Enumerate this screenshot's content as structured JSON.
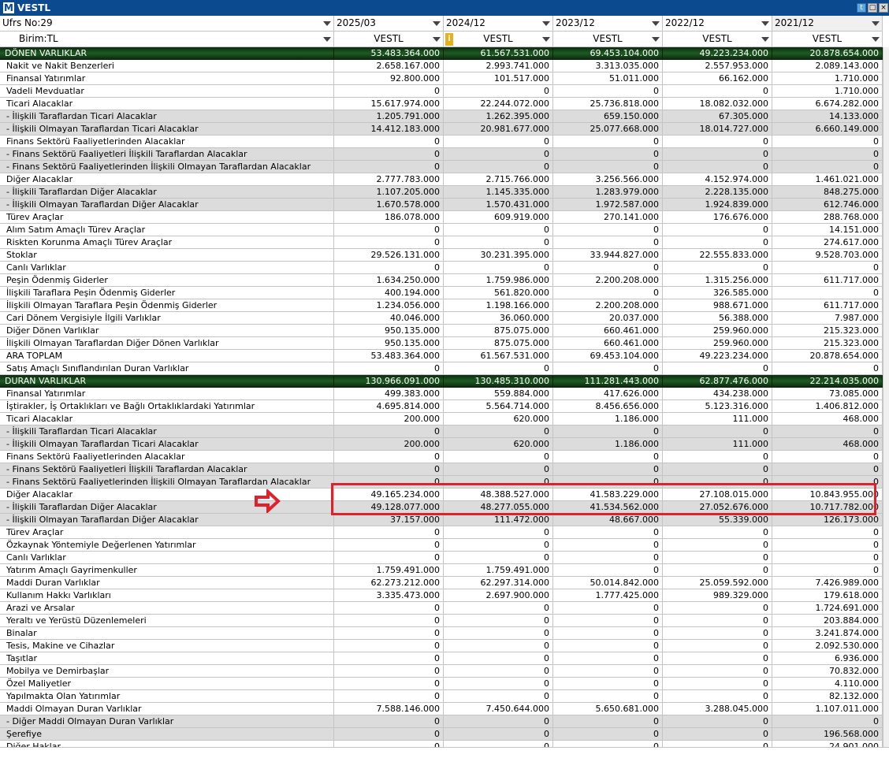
{
  "window": {
    "title": "VESTL",
    "logo": "M",
    "buttons": [
      "twitter-icon",
      "restore-icon",
      "close-icon"
    ]
  },
  "header": {
    "ufrs": "Ufrs No:29",
    "birim": "Birim:TL",
    "periods": [
      "2025/03",
      "2024/12",
      "2023/12",
      "2022/12",
      "2021/12"
    ],
    "tickers": [
      "VESTL",
      "VESTL",
      "VESTL",
      "VESTL",
      "VESTL"
    ],
    "info_icon": "i"
  },
  "rows": [
    {
      "label": "DÖNEN VARLIKLAR",
      "values": [
        "53.483.364.000",
        "61.567.531.000",
        "69.453.104.000",
        "49.223.234.000",
        "20.878.654.000"
      ],
      "type": "sec"
    },
    {
      "label": "Nakit ve Nakit Benzerleri",
      "values": [
        "2.658.167.000",
        "2.993.741.000",
        "3.313.035.000",
        "2.557.953.000",
        "2.089.143.000"
      ]
    },
    {
      "label": "Finansal Yatırımlar",
      "values": [
        "92.800.000",
        "101.517.000",
        "51.011.000",
        "66.162.000",
        "1.710.000"
      ]
    },
    {
      "label": "Vadeli Mevduatlar",
      "values": [
        "0",
        "0",
        "0",
        "0",
        "1.710.000"
      ]
    },
    {
      "label": "Ticari Alacaklar",
      "values": [
        "15.617.974.000",
        "22.244.072.000",
        "25.736.818.000",
        "18.082.032.000",
        "6.674.282.000"
      ]
    },
    {
      "label": "- İlişkili Taraflardan Ticari Alacaklar",
      "values": [
        "1.205.791.000",
        "1.262.395.000",
        "659.150.000",
        "67.305.000",
        "14.133.000"
      ],
      "type": "alt"
    },
    {
      "label": "- İlişkili Olmayan Taraflardan Ticari Alacaklar",
      "values": [
        "14.412.183.000",
        "20.981.677.000",
        "25.077.668.000",
        "18.014.727.000",
        "6.660.149.000"
      ],
      "type": "alt"
    },
    {
      "label": "Finans Sektörü Faaliyetlerinden Alacaklar",
      "values": [
        "0",
        "0",
        "0",
        "0",
        "0"
      ]
    },
    {
      "label": "- Finans Sektörü Faaliyetleri İlişkili Taraflardan Alacaklar",
      "values": [
        "0",
        "0",
        "0",
        "0",
        "0"
      ],
      "type": "alt"
    },
    {
      "label": "- Finans Sektörü Faaliyetlerinden İlişkili Olmayan Taraflardan Alacaklar",
      "values": [
        "0",
        "0",
        "0",
        "0",
        "0"
      ],
      "type": "alt"
    },
    {
      "label": "Diğer Alacaklar",
      "values": [
        "2.777.783.000",
        "2.715.766.000",
        "3.256.566.000",
        "4.152.974.000",
        "1.461.021.000"
      ]
    },
    {
      "label": "- İlişkili Taraflardan Diğer Alacaklar",
      "values": [
        "1.107.205.000",
        "1.145.335.000",
        "1.283.979.000",
        "2.228.135.000",
        "848.275.000"
      ],
      "type": "alt"
    },
    {
      "label": "- İlişkili Olmayan Taraflardan Diğer Alacaklar",
      "values": [
        "1.670.578.000",
        "1.570.431.000",
        "1.972.587.000",
        "1.924.839.000",
        "612.746.000"
      ],
      "type": "alt"
    },
    {
      "label": "Türev Araçlar",
      "values": [
        "186.078.000",
        "609.919.000",
        "270.141.000",
        "176.676.000",
        "288.768.000"
      ]
    },
    {
      "label": "Alım Satım Amaçlı Türev Araçlar",
      "values": [
        "0",
        "0",
        "0",
        "0",
        "14.151.000"
      ]
    },
    {
      "label": "Riskten Korunma Amaçlı Türev Araçlar",
      "values": [
        "0",
        "0",
        "0",
        "0",
        "274.617.000"
      ]
    },
    {
      "label": "Stoklar",
      "values": [
        "29.526.131.000",
        "30.231.395.000",
        "33.944.827.000",
        "22.555.833.000",
        "9.528.703.000"
      ]
    },
    {
      "label": "Canlı Varlıklar",
      "values": [
        "0",
        "0",
        "0",
        "0",
        "0"
      ]
    },
    {
      "label": "Peşin Ödenmiş Giderler",
      "values": [
        "1.634.250.000",
        "1.759.986.000",
        "2.200.208.000",
        "1.315.256.000",
        "611.717.000"
      ]
    },
    {
      "label": "İlişkili Taraflara Peşin Ödenmiş Giderler",
      "values": [
        "400.194.000",
        "561.820.000",
        "0",
        "326.585.000",
        "0"
      ]
    },
    {
      "label": "İlişkili Olmayan Taraflara Peşin Ödenmiş Giderler",
      "values": [
        "1.234.056.000",
        "1.198.166.000",
        "2.200.208.000",
        "988.671.000",
        "611.717.000"
      ]
    },
    {
      "label": "Cari Dönem Vergisiyle İlgili Varlıklar",
      "values": [
        "40.046.000",
        "36.060.000",
        "20.037.000",
        "56.388.000",
        "7.987.000"
      ]
    },
    {
      "label": "Diğer Dönen Varlıklar",
      "values": [
        "950.135.000",
        "875.075.000",
        "660.461.000",
        "259.960.000",
        "215.323.000"
      ]
    },
    {
      "label": "İlişkili Olmayan Taraflardan Diğer Dönen Varlıklar",
      "values": [
        "950.135.000",
        "875.075.000",
        "660.461.000",
        "259.960.000",
        "215.323.000"
      ]
    },
    {
      "label": "ARA TOPLAM",
      "values": [
        "53.483.364.000",
        "61.567.531.000",
        "69.453.104.000",
        "49.223.234.000",
        "20.878.654.000"
      ]
    },
    {
      "label": "Satış Amaçlı Sınıflandırılan Duran Varlıklar",
      "values": [
        "0",
        "0",
        "0",
        "0",
        "0"
      ]
    },
    {
      "label": "DURAN VARLIKLAR",
      "values": [
        "130.966.091.000",
        "130.485.310.000",
        "111.281.443.000",
        "62.877.476.000",
        "22.214.035.000"
      ],
      "type": "sec"
    },
    {
      "label": "Finansal Yatırımlar",
      "values": [
        "499.383.000",
        "559.884.000",
        "417.626.000",
        "434.238.000",
        "73.085.000"
      ]
    },
    {
      "label": "İştirakler, İş Ortaklıkları ve Bağlı Ortaklıklardaki Yatırımlar",
      "values": [
        "4.695.814.000",
        "5.564.714.000",
        "8.456.656.000",
        "5.123.316.000",
        "1.406.812.000"
      ]
    },
    {
      "label": "Ticari Alacaklar",
      "values": [
        "200.000",
        "620.000",
        "1.186.000",
        "111.000",
        "468.000"
      ]
    },
    {
      "label": "- İlişkili Taraflardan Ticari Alacaklar",
      "values": [
        "0",
        "0",
        "0",
        "0",
        "0"
      ],
      "type": "alt"
    },
    {
      "label": "- İlişkili Olmayan Taraflardan Ticari Alacaklar",
      "values": [
        "200.000",
        "620.000",
        "1.186.000",
        "111.000",
        "468.000"
      ],
      "type": "alt"
    },
    {
      "label": "Finans Sektörü Faaliyetlerinden Alacaklar",
      "values": [
        "0",
        "0",
        "0",
        "0",
        "0"
      ]
    },
    {
      "label": "- Finans Sektörü Faaliyetleri İlişkili Taraflardan Alacaklar",
      "values": [
        "0",
        "0",
        "0",
        "0",
        "0"
      ],
      "type": "alt"
    },
    {
      "label": "- Finans Sektörü Faaliyetlerinden İlişkili Olmayan Taraflardan Alacaklar",
      "values": [
        "0",
        "0",
        "0",
        "0",
        "0"
      ],
      "type": "alt"
    },
    {
      "label": "Diğer Alacaklar",
      "values": [
        "49.165.234.000",
        "48.388.527.000",
        "41.583.229.000",
        "27.108.015.000",
        "10.843.955.000"
      ]
    },
    {
      "label": "- İlişkili Taraflardan Diğer Alacaklar",
      "values": [
        "49.128.077.000",
        "48.277.055.000",
        "41.534.562.000",
        "27.052.676.000",
        "10.717.782.000"
      ],
      "type": "alt"
    },
    {
      "label": "- İlişkili Olmayan Taraflardan Diğer Alacaklar",
      "values": [
        "37.157.000",
        "111.472.000",
        "48.667.000",
        "55.339.000",
        "126.173.000"
      ],
      "type": "alt"
    },
    {
      "label": "Türev Araçlar",
      "values": [
        "0",
        "0",
        "0",
        "0",
        "0"
      ]
    },
    {
      "label": "Özkaynak Yöntemiyle Değerlenen Yatırımlar",
      "values": [
        "0",
        "0",
        "0",
        "0",
        "0"
      ]
    },
    {
      "label": "Canlı Varlıklar",
      "values": [
        "0",
        "0",
        "0",
        "0",
        "0"
      ]
    },
    {
      "label": "Yatırım Amaçlı Gayrimenkuller",
      "values": [
        "1.759.491.000",
        "1.759.491.000",
        "0",
        "0",
        "0"
      ]
    },
    {
      "label": "Maddi Duran Varlıklar",
      "values": [
        "62.273.212.000",
        "62.297.314.000",
        "50.014.842.000",
        "25.059.592.000",
        "7.426.989.000"
      ]
    },
    {
      "label": "Kullanım Hakkı Varlıkları",
      "values": [
        "3.335.473.000",
        "2.697.900.000",
        "1.777.425.000",
        "989.329.000",
        "179.618.000"
      ]
    },
    {
      "label": "Arazi ve Arsalar",
      "values": [
        "0",
        "0",
        "0",
        "0",
        "1.724.691.000"
      ]
    },
    {
      "label": "Yeraltı ve Yerüstü Düzenlemeleri",
      "values": [
        "0",
        "0",
        "0",
        "0",
        "203.884.000"
      ]
    },
    {
      "label": "Binalar",
      "values": [
        "0",
        "0",
        "0",
        "0",
        "3.241.874.000"
      ]
    },
    {
      "label": "Tesis, Makine ve Cihazlar",
      "values": [
        "0",
        "0",
        "0",
        "0",
        "2.092.530.000"
      ]
    },
    {
      "label": "Taşıtlar",
      "values": [
        "0",
        "0",
        "0",
        "0",
        "6.936.000"
      ]
    },
    {
      "label": "Mobilya ve Demirbaşlar",
      "values": [
        "0",
        "0",
        "0",
        "0",
        "70.832.000"
      ]
    },
    {
      "label": "Özel Maliyetler",
      "values": [
        "0",
        "0",
        "0",
        "0",
        "4.110.000"
      ]
    },
    {
      "label": "Yapılmakta Olan Yatırımlar",
      "values": [
        "0",
        "0",
        "0",
        "0",
        "82.132.000"
      ]
    },
    {
      "label": "Maddi Olmayan Duran Varlıklar",
      "values": [
        "7.588.146.000",
        "7.450.644.000",
        "5.650.681.000",
        "3.288.045.000",
        "1.107.011.000"
      ]
    },
    {
      "label": "- Diğer Maddi Olmayan Duran Varlıklar",
      "values": [
        "0",
        "0",
        "0",
        "0",
        "0"
      ],
      "type": "alt"
    },
    {
      "label": "Şerefiye",
      "values": [
        "0",
        "0",
        "0",
        "0",
        "196.568.000"
      ],
      "type": "alt"
    },
    {
      "label": "Diğer Haklar",
      "values": [
        "0",
        "0",
        "0",
        "0",
        "24.901.000"
      ]
    }
  ],
  "annotation": {
    "highlight_color": "#e0202a",
    "arrow": "right-arrow-icon"
  }
}
